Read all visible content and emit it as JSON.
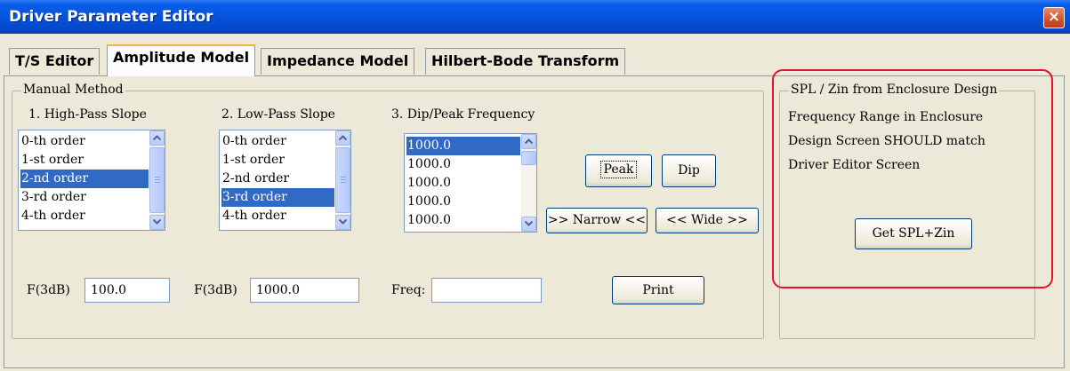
{
  "window": {
    "title": "Driver Parameter Editor",
    "close_glyph": "×"
  },
  "tabs": [
    {
      "label": "T/S Editor"
    },
    {
      "label": "Amplitude Model"
    },
    {
      "label": "Impedance Model"
    },
    {
      "label": "Hilbert-Bode Transform"
    }
  ],
  "manual": {
    "legend": "Manual Method",
    "highpass": {
      "label": "1. High-Pass Slope",
      "items": [
        "0-th order",
        "1-st order",
        "2-nd order",
        "3-rd order",
        "4-th order"
      ],
      "selected": "2-nd order",
      "f3db_label": "F(3dB)",
      "f3db_value": "100.0"
    },
    "lowpass": {
      "label": "2. Low-Pass Slope",
      "items": [
        "0-th order",
        "1-st order",
        "2-nd order",
        "3-rd order",
        "4-th order"
      ],
      "selected": "3-rd order",
      "f3db_label": "F(3dB)",
      "f3db_value": "1000.0"
    },
    "dippeak": {
      "label": "3. Dip/Peak Frequency",
      "items": [
        "1000.0",
        "1000.0",
        "1000.0",
        "1000.0",
        "1000.0"
      ],
      "selected_index": 0,
      "freq_label": "Freq:",
      "freq_value": ""
    },
    "buttons": {
      "peak": "Peak",
      "dip": "Dip",
      "narrow": ">> Narrow <<",
      "wide": "<< Wide >>",
      "print": "Print"
    }
  },
  "spl": {
    "legend": "SPL / Zin from Enclosure Design",
    "text_lines": [
      "Frequency Range in Enclosure",
      "Design Screen SHOULD match",
      "Driver Editor Screen"
    ],
    "button": "Get SPL+Zin"
  },
  "colors": {
    "selection": "#316ac5",
    "highlight": "#e8102d",
    "titlebar": "#0553dc"
  }
}
